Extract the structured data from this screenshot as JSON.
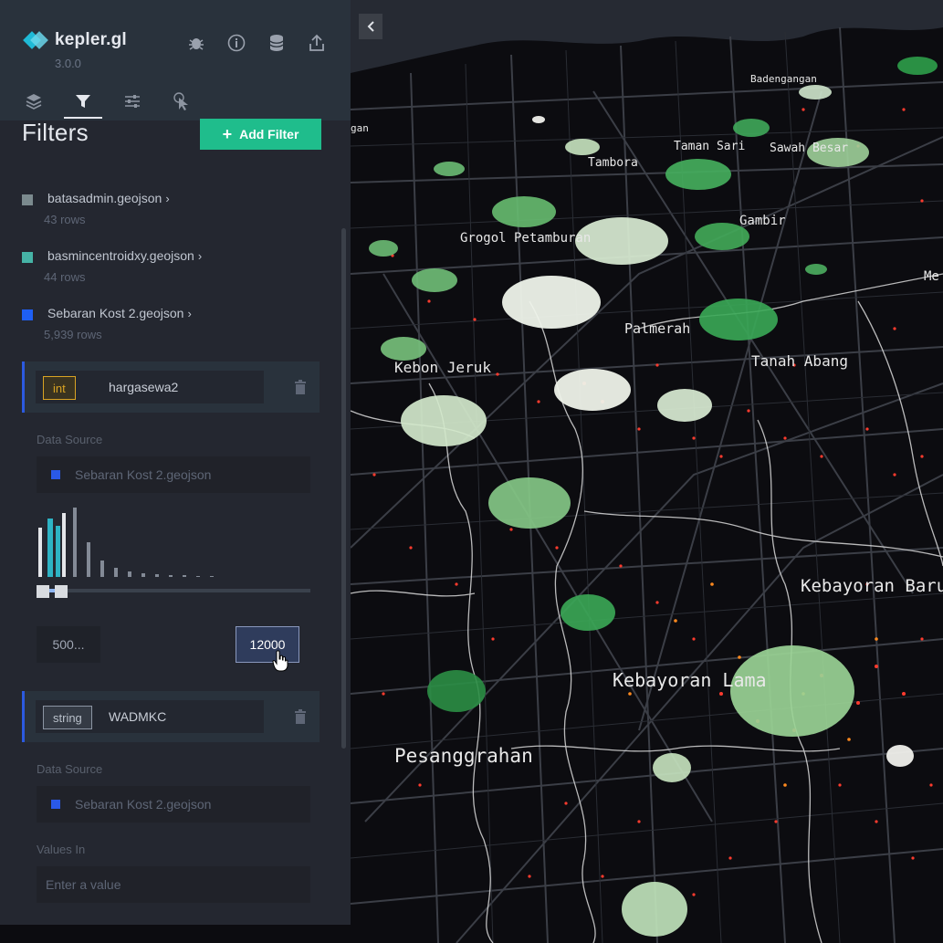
{
  "app": {
    "name": "kepler.gl",
    "version": "3.0.0"
  },
  "header_icons": [
    "bug-icon",
    "info-icon",
    "database-icon",
    "share-icon"
  ],
  "tabs": [
    {
      "name": "layers-icon",
      "active": false
    },
    {
      "name": "filter-icon",
      "active": true
    },
    {
      "name": "settings-sliders-icon",
      "active": false
    },
    {
      "name": "interaction-cursor-icon",
      "active": false
    }
  ],
  "panel": {
    "title": "Filters",
    "add_filter_label": "Add Filter",
    "datasets": [
      {
        "name": "batasadmin.geojson",
        "rows": "43 rows",
        "color": "#7b8a8e"
      },
      {
        "name": "basmincentroidxy.geojson",
        "rows": "44 rows",
        "color": "#46b3a6"
      },
      {
        "name": "Sebaran Kost 2.geojson",
        "rows": "5,939 rows",
        "color": "#1e5ff5"
      }
    ],
    "filters": [
      {
        "type": "int",
        "field": "hargasewa2",
        "data_source_label": "Data Source",
        "data_source": "Sebaran Kost 2.geojson",
        "range_min": "500...",
        "range_max": "12000"
      },
      {
        "type": "string",
        "field": "WADMKC",
        "data_source_label": "Data Source",
        "data_source": "Sebaran Kost 2.geojson",
        "values_label": "Values In",
        "values_placeholder": "Enter a value"
      }
    ]
  },
  "map": {
    "labels": [
      "Badengangan",
      "Taman Sari",
      "Sawah Besar",
      "Tambora",
      "Gambir",
      "Grogol Petamburan",
      "Palmerah",
      "Tanah Abang",
      "Kebon Jeruk",
      "Kebayoran Baru",
      "Kebayoran Lama",
      "Pesanggrahan",
      "Me",
      "gan"
    ]
  },
  "colors": {
    "accent": "#1fbd8c",
    "panel": "#242730",
    "header": "#29323c",
    "selected": "#2c5ae0"
  }
}
